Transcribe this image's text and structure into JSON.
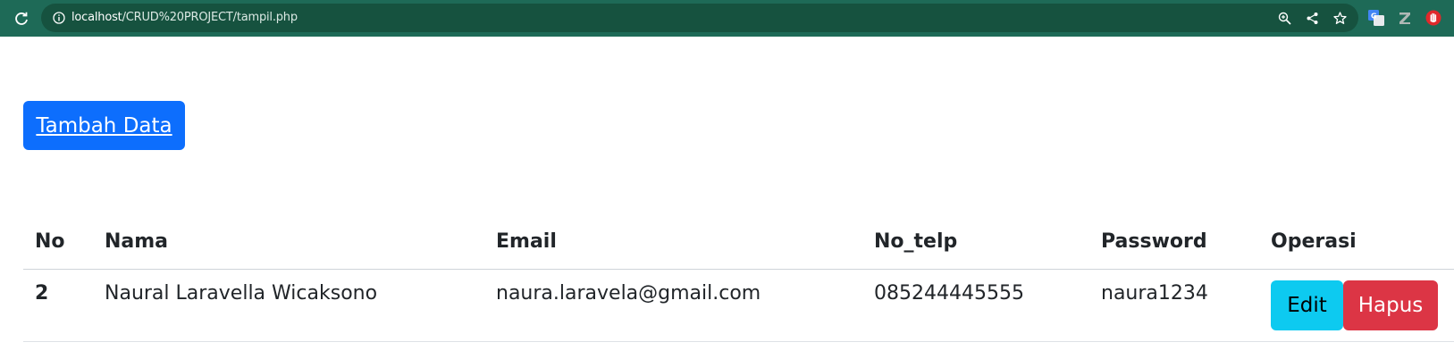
{
  "browser": {
    "url_host": "localhost",
    "url_path": "/CRUD%20PROJECT/tampil.php",
    "icons": {
      "reload": "reload-icon",
      "site_info": "info-icon",
      "zoom": "zoom-icon",
      "share": "share-icon",
      "bookmark": "star-icon",
      "ext_translate": "translate-icon",
      "ext_zotero": "z-extension-icon",
      "ext_blocker": "hand-stop-icon"
    },
    "colors": {
      "toolbar": "#1e6a57",
      "omnibox": "#16523f"
    }
  },
  "page": {
    "add_button_label": "Tambah Data",
    "table": {
      "headers": [
        "No",
        "Nama",
        "Email",
        "No_telp",
        "Password",
        "Operasi"
      ],
      "rows": [
        {
          "no": "2",
          "nama": "Naural Laravella Wicaksono",
          "email": "naura.laravela@gmail.com",
          "no_telp": "085244445555",
          "password": "naura1234",
          "edit_label": "Edit",
          "delete_label": "Hapus"
        }
      ]
    },
    "colors": {
      "add_button": "#0d6efd",
      "edit_button": "#0dcaf0",
      "delete_button": "#dc3545"
    }
  }
}
